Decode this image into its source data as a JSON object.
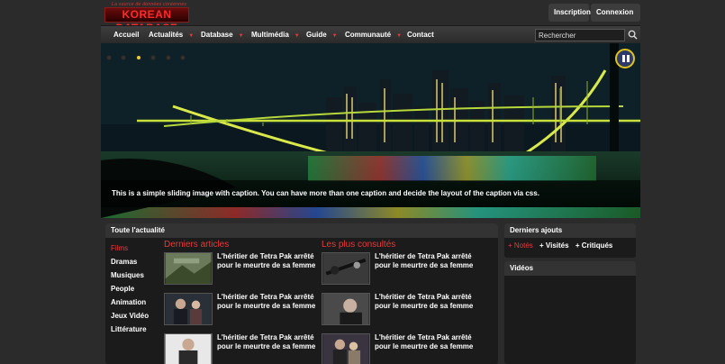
{
  "header": {
    "tagline": "La source de données coréennes",
    "logo_text": "KOREAN DATABASE",
    "inscription": "Inscription",
    "connexion": "Connexion"
  },
  "nav": {
    "items": [
      {
        "label": "Accueil",
        "dropdown": false
      },
      {
        "label": "Actualités",
        "dropdown": true
      },
      {
        "label": "Database",
        "dropdown": true
      },
      {
        "label": "Multimédia",
        "dropdown": true
      },
      {
        "label": "Guide",
        "dropdown": true
      },
      {
        "label": "Communauté",
        "dropdown": true
      },
      {
        "label": "Contact",
        "dropdown": false
      }
    ],
    "search_placeholder": "Rechercher"
  },
  "slider": {
    "active_dot": 3,
    "caption": "This is a simple sliding image with caption. You can have more than one caption and decide the layout of the caption via css."
  },
  "news": {
    "title": "Toute l'actualité",
    "categories": [
      "Films",
      "Dramas",
      "Musiques",
      "People",
      "Animation",
      "Jeux Vidéo",
      "Littérature"
    ],
    "latest_title": "Derniers articles",
    "popular_title": "Les plus consultés",
    "latest": [
      {
        "title": "L'héritier de Tetra Pak arrêté pour le meurtre de sa femme"
      },
      {
        "title": "L'héritier de Tetra Pak arrêté pour le meurtre de sa femme"
      },
      {
        "title": "L'héritier de Tetra Pak arrêté pour le meurtre de sa femme"
      }
    ],
    "popular": [
      {
        "title": "L'héritier de Tetra Pak arrêté pour le meurtre de sa femme"
      },
      {
        "title": "L'héritier de Tetra Pak arrêté pour le meurtre de sa femme"
      },
      {
        "title": "L'héritier de Tetra Pak arrêté pour le meurtre de sa femme"
      }
    ]
  },
  "side": {
    "recent_title": "Derniers ajouts",
    "tabs": [
      "+ Notés",
      "+ Visités",
      "+ Critiqués"
    ],
    "videos_title": "Vidéos"
  },
  "colors": {
    "accent": "#e63a3a",
    "panel": "#1b1b1b",
    "background": "#2b2b2b"
  }
}
